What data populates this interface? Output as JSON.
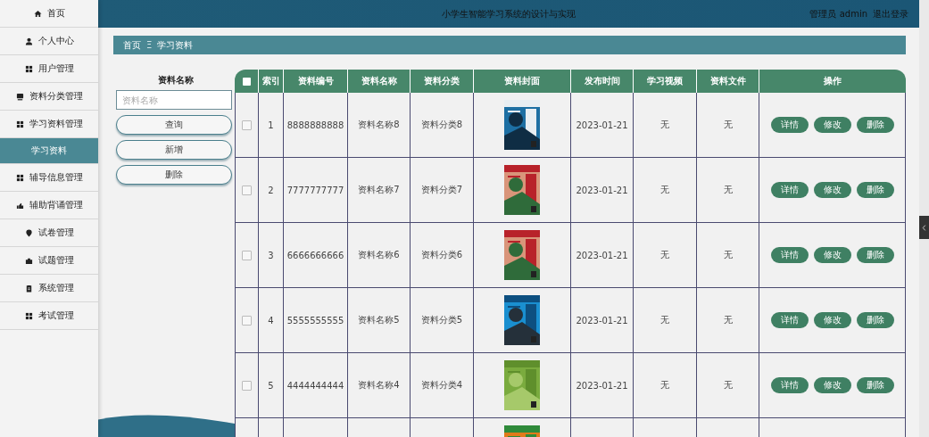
{
  "sidebar": {
    "items": [
      {
        "label": "首页",
        "selected": false
      },
      {
        "label": "个人中心",
        "selected": false
      },
      {
        "label": "用户管理",
        "selected": false
      },
      {
        "label": "资料分类管理",
        "selected": false
      },
      {
        "label": "学习资料管理",
        "selected": false,
        "children": [
          {
            "label": "学习资料",
            "selected": true
          }
        ]
      },
      {
        "label": "辅导信息管理",
        "selected": false
      },
      {
        "label": "辅助背诵管理",
        "selected": false
      },
      {
        "label": "试卷管理",
        "selected": false
      },
      {
        "label": "试题管理",
        "selected": false
      },
      {
        "label": "系统管理",
        "selected": false
      },
      {
        "label": "考试管理",
        "selected": false
      }
    ]
  },
  "header": {
    "title": "小学生智能学习系统的设计与实现",
    "user": "管理员 admin",
    "logout": "退出登录"
  },
  "breadcrumb": {
    "home": "首页",
    "separator": "Ξ",
    "current": "学习资料"
  },
  "search": {
    "label": "资料名称",
    "placeholder": "资料名称",
    "buttons": [
      "查询",
      "新增",
      "删除"
    ]
  },
  "table": {
    "select_all_checked": false,
    "columns": [
      "索引",
      "资料编号",
      "资料名称",
      "资料分类",
      "资料封面",
      "发布时间",
      "学习视频",
      "资料文件",
      "操作"
    ],
    "rows": [
      {
        "checked": false,
        "index": "1",
        "code": "8888888888",
        "name": "资料名称8",
        "category": "资料分类8",
        "cover": {
          "kind": "picture"
        },
        "date": "2023-01-21",
        "video": "无",
        "file": "无",
        "actions": [
          "详情",
          "修改",
          "删除"
        ]
      },
      {
        "checked": false,
        "index": "2",
        "code": "7777777777",
        "name": "资料名称7",
        "category": "资料分类7",
        "cover": {
          "kind": "picture"
        },
        "date": "2023-01-21",
        "video": "无",
        "file": "无",
        "actions": [
          "详情",
          "修改",
          "删除"
        ]
      },
      {
        "checked": false,
        "index": "3",
        "code": "6666666666",
        "name": "资料名称6",
        "category": "资料分类6",
        "cover": {
          "kind": "picture"
        },
        "date": "2023-01-21",
        "video": "无",
        "file": "无",
        "actions": [
          "详情",
          "修改",
          "删除"
        ]
      },
      {
        "checked": false,
        "index": "4",
        "code": "5555555555",
        "name": "资料名称5",
        "category": "资料分类5",
        "cover": {
          "kind": "picture"
        },
        "date": "2023-01-21",
        "video": "无",
        "file": "无",
        "actions": [
          "详情",
          "修改",
          "删除"
        ]
      },
      {
        "checked": false,
        "index": "5",
        "code": "4444444444",
        "name": "资料名称4",
        "category": "资料分类4",
        "cover": {
          "kind": "picture"
        },
        "date": "2023-01-21",
        "video": "无",
        "file": "无",
        "actions": [
          "详情",
          "修改",
          "删除"
        ]
      },
      {
        "cover": {
          "kind": "picture"
        }
      }
    ]
  }
}
